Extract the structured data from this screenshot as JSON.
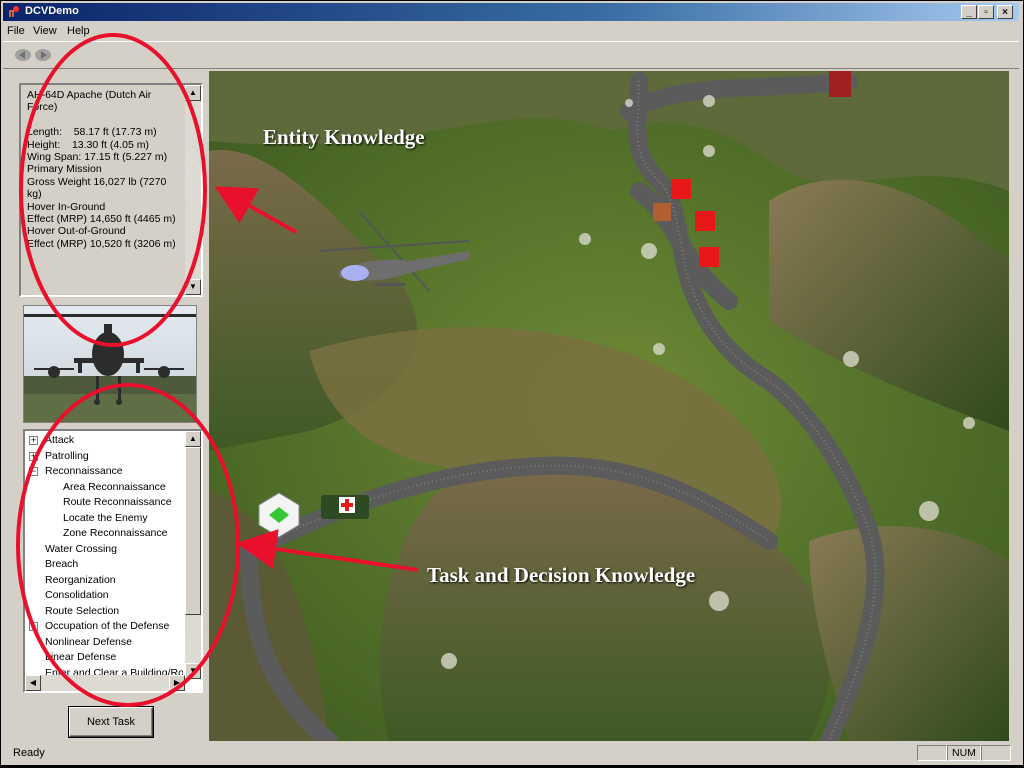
{
  "window": {
    "title": "DCVDemo",
    "min_glyph": "_",
    "max_glyph": "▫",
    "close_glyph": "×"
  },
  "menu": {
    "items": [
      "File",
      "View",
      "Help"
    ]
  },
  "entity_info": {
    "text": "AH-64D Apache (Dutch Air Force)\n\nLength:    58.17 ft (17.73 m)\nHeight:    13.30 ft (4.05 m)\nWing Span: 17.15 ft (5.227 m)\nPrimary Mission\nGross Weight 16,027 lb (7270 kg)\nHover In-Ground\nEffect (MRP) 14,650 ft (4465 m)\nHover Out-of-Ground\nEffect (MRP) 10,520 ft (3206 m)"
  },
  "task_tree": {
    "items": [
      {
        "label": "Attack",
        "expander": "+"
      },
      {
        "label": "Patrolling",
        "expander": "+"
      },
      {
        "label": "Reconnaissance",
        "expander": "−"
      },
      {
        "label": "Area Reconnaissance"
      },
      {
        "label": "Route Reconnaissance"
      },
      {
        "label": "Locate the Enemy"
      },
      {
        "label": "Zone Reconnaissance"
      },
      {
        "label": "Water Crossing"
      },
      {
        "label": "Breach"
      },
      {
        "label": "Reorganization"
      },
      {
        "label": "Consolidation"
      },
      {
        "label": "Route Selection"
      },
      {
        "label": "Occupation of the Defense",
        "expander": "+"
      },
      {
        "label": "Nonlinear Defense"
      },
      {
        "label": "Linear Defense"
      },
      {
        "label": "Enter and Clear a Building/Ro"
      }
    ]
  },
  "next_task_label": "Next Task",
  "status": {
    "text": "Ready",
    "num": "NUM"
  },
  "annotations": {
    "entity": "Entity Knowledge",
    "task": "Task and Decision Knowledge"
  },
  "colors": {
    "annotation_ring": "#e8102a",
    "titlebar": "#0a246a"
  }
}
